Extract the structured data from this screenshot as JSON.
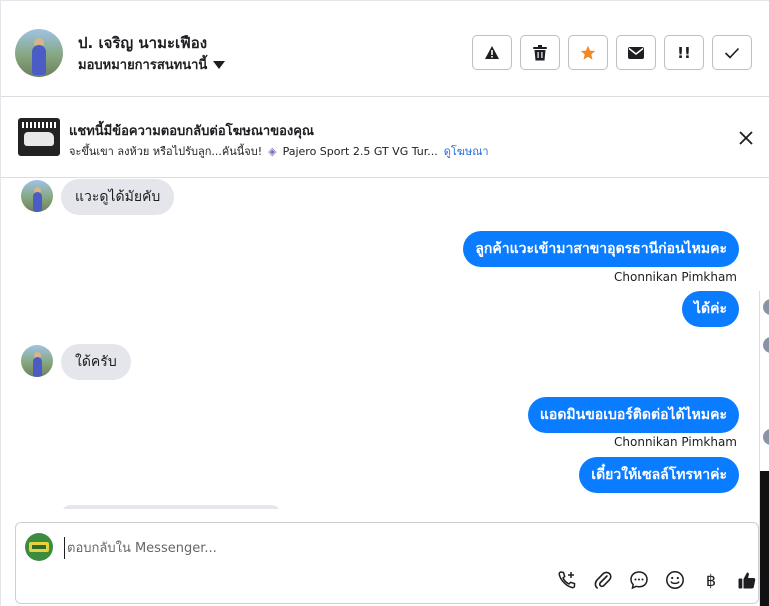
{
  "header": {
    "name": "ป. เจริญ นามะเฟือง",
    "assign_label": "มอบหมายการสนทนานี้",
    "toolbar": [
      {
        "name": "warning-button",
        "icon": "warning-icon"
      },
      {
        "name": "delete-button",
        "icon": "trash-icon"
      },
      {
        "name": "star-button",
        "icon": "star-icon",
        "color": "#f08a24"
      },
      {
        "name": "mail-button",
        "icon": "envelope-icon"
      },
      {
        "name": "follow-up-button",
        "icon": "double-exclamation-icon",
        "label": "!!"
      },
      {
        "name": "done-button",
        "icon": "check-icon"
      }
    ]
  },
  "ad_banner": {
    "title": "แชทนี้มีข้อความตอบกลับต่อโฆษณาของคุณ",
    "snippet": "จะขึ้นเขา ลงห้วย หรือไปรับลูก...คันนี้จบ!",
    "car_title": "Pajero Sport 2.5 GT VG Tur...",
    "link": "ดูโฆษณา"
  },
  "messages": [
    {
      "type": "in",
      "text": "แวะดูได้มัยคับ"
    },
    {
      "type": "out",
      "text": "ลูกค้าแวะเข้ามาสาขาอุดรธานีก่อนไหมคะ",
      "sender": "Chonnikan Pimkham"
    },
    {
      "type": "out",
      "text": "ได้ค่ะ"
    },
    {
      "type": "in",
      "text": "ใด้ครับ"
    },
    {
      "type": "out",
      "text": "แอดมินขอเบอร์ติดต่อได้ไหมคะ",
      "sender": "Chonnikan Pimkham"
    },
    {
      "type": "out",
      "text": "เดี๋ยวให้เซลล์โทรหาค่ะ"
    }
  ],
  "composer": {
    "placeholder": "ตอบกลับใน Messenger...",
    "tools": [
      {
        "name": "call-add-icon",
        "glyph": ""
      },
      {
        "name": "attachment-icon",
        "glyph": ""
      },
      {
        "name": "saved-reply-icon",
        "glyph": ""
      },
      {
        "name": "emoji-icon",
        "glyph": ""
      },
      {
        "name": "payment-baht-icon",
        "glyph": "฿"
      },
      {
        "name": "thumbs-up-icon",
        "glyph": ""
      }
    ]
  },
  "colors": {
    "accent": "#0a7cff",
    "star": "#f08a24",
    "incoming_bubble": "#e4e6eb",
    "link": "#216fdb"
  }
}
